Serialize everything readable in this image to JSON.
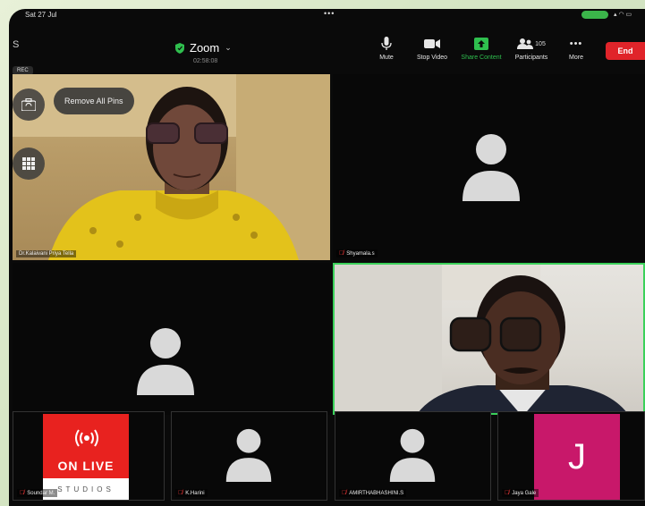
{
  "status": {
    "time": "Sat 27 Jul",
    "dots": "•••"
  },
  "meeting": {
    "title": "Zoom",
    "timer": "02:58:08"
  },
  "toolbar": {
    "mute": "Mute",
    "stop_video": "Stop Video",
    "share_content": "Share Content",
    "participants": "Participants",
    "participants_count": "105",
    "more": "More",
    "more_glyph": "•••",
    "end": "End"
  },
  "rec_label": "REC",
  "left_edge_glyph": "S",
  "remove_all_pins": "Remove All Pins",
  "tiles": {
    "t1": {
      "name": "Dr.Kalaivani Priya Tella"
    },
    "t2": {
      "name": "Shyamala.s"
    },
    "t3": {
      "name": ""
    },
    "t4": {
      "name": ""
    },
    "t5": {
      "name": "Soundar M."
    },
    "t6": {
      "name": "K.Harini"
    },
    "t7": {
      "name": "AMIRTHABHASHINI.S"
    },
    "t8": {
      "name": "Jaya Gale"
    }
  },
  "onlive": {
    "title": "ON LIVE",
    "sub": "STUDIOS"
  },
  "jaya_initial": "J",
  "colors": {
    "accent_green": "#2fbf4e",
    "end_red": "#e0242a",
    "active_border": "#3bd15a",
    "onlive_red": "#e8221f",
    "j_magenta": "#c8186a"
  },
  "icons": [
    "shield-icon",
    "mic-icon",
    "video-icon",
    "share-icon",
    "participants-icon",
    "more-icon",
    "camera-flip-icon",
    "keypad-icon",
    "avatar-icon",
    "mic-off-icon",
    "live-broadcast-icon"
  ]
}
